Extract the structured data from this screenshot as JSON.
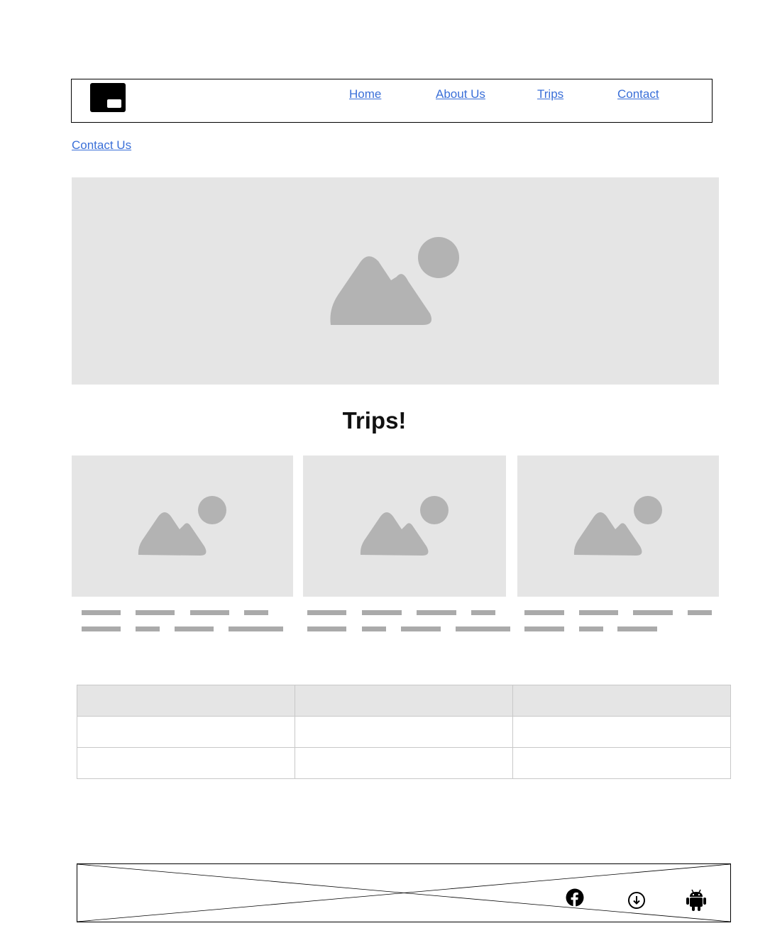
{
  "header": {
    "logo_icon": "logo-icon",
    "nav": [
      {
        "label": "Home"
      },
      {
        "label": "About Us"
      },
      {
        "label": "Trips"
      },
      {
        "label": "Contact"
      }
    ]
  },
  "contact_link": "Contact Us",
  "hero": {
    "icon": "image-placeholder-icon"
  },
  "section_title": "Trips!",
  "trip_cards": [
    {
      "icon": "image-placeholder-icon"
    },
    {
      "icon": "image-placeholder-icon"
    },
    {
      "icon": "image-placeholder-icon"
    }
  ],
  "table": {
    "headers": [
      "",
      "",
      ""
    ],
    "rows": [
      [
        "",
        "",
        ""
      ],
      [
        "",
        "",
        ""
      ]
    ]
  },
  "footer": {
    "icons": [
      "facebook-icon",
      "download-icon",
      "android-icon"
    ]
  },
  "colors": {
    "link": "#3a6fd8",
    "placeholder_bg": "#e5e5e5",
    "placeholder_fg": "#b3b3b3",
    "table_header_bg": "#e5e5e5"
  }
}
